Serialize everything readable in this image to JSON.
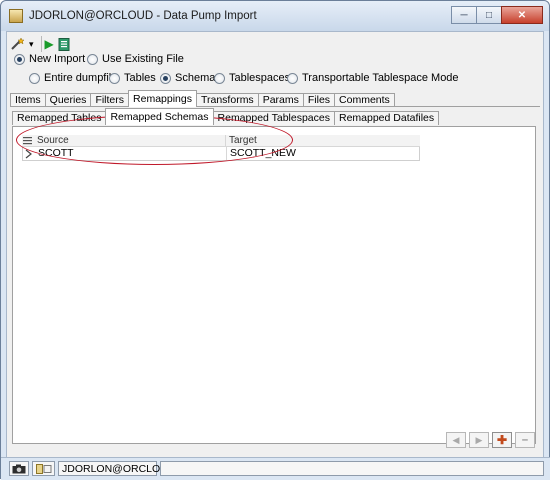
{
  "window": {
    "title": "JDORLON@ORCLOUD - Data Pump Import",
    "controls": {
      "minimize": "─",
      "maximize": "□",
      "close": "✕"
    }
  },
  "toolbar": {
    "dropdown_arrow": "▾",
    "run_icon": "▶"
  },
  "import_mode": {
    "options": [
      {
        "label": "New Import",
        "selected": true
      },
      {
        "label": "Use Existing File",
        "selected": false
      }
    ]
  },
  "scope": {
    "options": [
      {
        "label": "Entire dumpfile",
        "selected": false
      },
      {
        "label": "Tables",
        "selected": false
      },
      {
        "label": "Schemas",
        "selected": true
      },
      {
        "label": "Tablespaces",
        "selected": false
      },
      {
        "label": "Transportable Tablespace Mode",
        "selected": false
      }
    ]
  },
  "main_tabs": {
    "items": [
      "Items",
      "Queries",
      "Filters",
      "Remappings",
      "Transforms",
      "Params",
      "Files",
      "Comments"
    ],
    "active": "Remappings"
  },
  "sub_tabs": {
    "items": [
      "Remapped Tables",
      "Remapped Schemas",
      "Remapped Tablespaces",
      "Remapped Datafiles"
    ],
    "active": "Remapped Schemas"
  },
  "grid": {
    "columns": [
      "Source",
      "Target"
    ],
    "rows": [
      {
        "source": "SCOTT",
        "target": "SCOTT_NEW"
      }
    ]
  },
  "row_buttons": {
    "prev": "◀",
    "next": "▶",
    "add": "✚",
    "remove": "━"
  },
  "status": {
    "connection": "JDORLON@ORCLOUD"
  },
  "colors": {
    "annotation_ellipse": "#c0192a",
    "selected_radio": "#27405f"
  }
}
